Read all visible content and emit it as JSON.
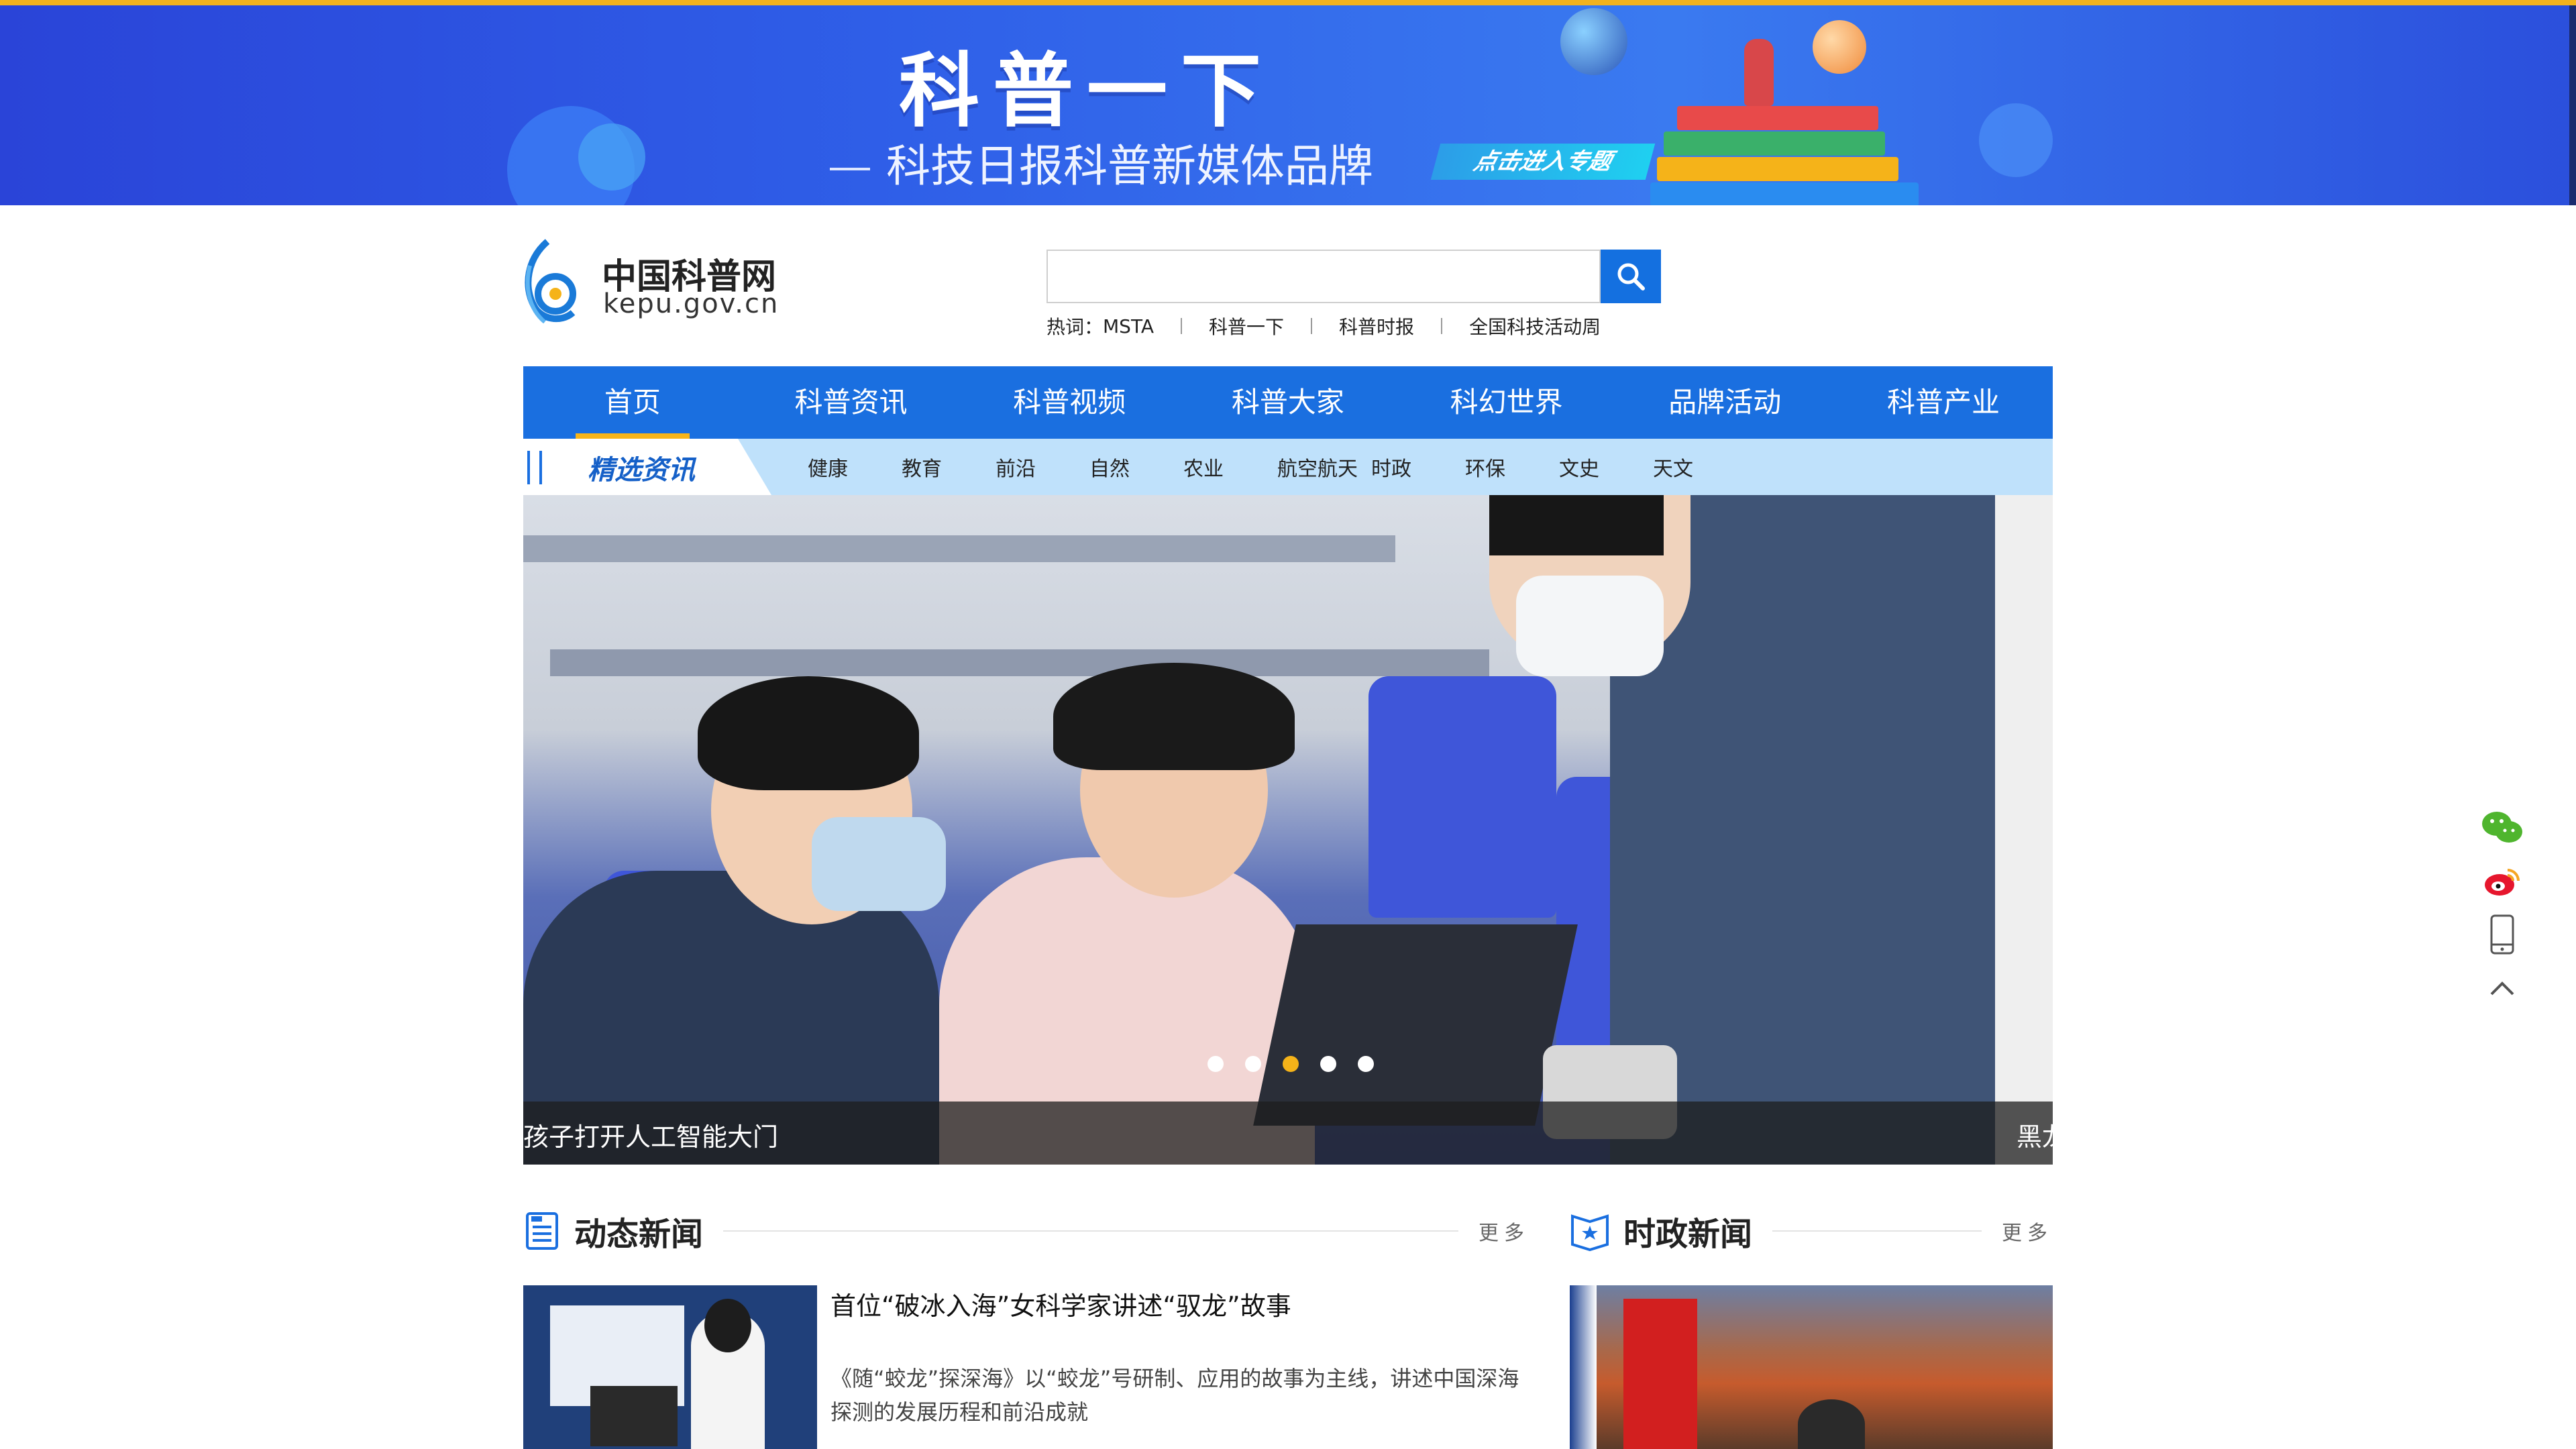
{
  "banner": {
    "title": "科普一下",
    "subtitle": "科技日报科普新媒体品牌",
    "cta": "点击进入专题"
  },
  "logo": {
    "name": "中国科普网",
    "domain": "kepu.gov.cn"
  },
  "search": {
    "value": "",
    "hot_label": "热词：",
    "hot_words": [
      "MSTA",
      "科普一下",
      "科普时报",
      "全国科技活动周"
    ]
  },
  "main_nav": [
    "首页",
    "科普资讯",
    "科普视频",
    "科普大家",
    "科幻世界",
    "品牌活动",
    "科普产业"
  ],
  "sub_nav": {
    "title": "精选资讯",
    "links": [
      "健康",
      "教育",
      "前沿",
      "自然",
      "农业",
      "航空航天",
      "时政",
      "环保",
      "文史",
      "天文"
    ]
  },
  "hero": {
    "caption_left": "孩子打开人工智能大门",
    "caption_right": "黑龙",
    "slide_count": 5,
    "active_slide": 3
  },
  "section_dynamic": {
    "title": "动态新闻",
    "more": "更多",
    "article_title": "首位“破冰入海”女科学家讲述“驭龙”故事",
    "article_summary": "《随“蛟龙”探深海》以“蛟龙”号研制、应用的故事为主线，讲述中国深海探测的发展历程和前沿成就"
  },
  "section_politics": {
    "title": "时政新闻",
    "more": "更多"
  },
  "side_icons": [
    "wechat-icon",
    "weibo-icon",
    "mobile-icon",
    "back-to-top-icon"
  ],
  "colors": {
    "primary_blue": "#1a6fe0",
    "accent_yellow": "#f5b319",
    "subnav_bg": "#bfe1fb"
  }
}
